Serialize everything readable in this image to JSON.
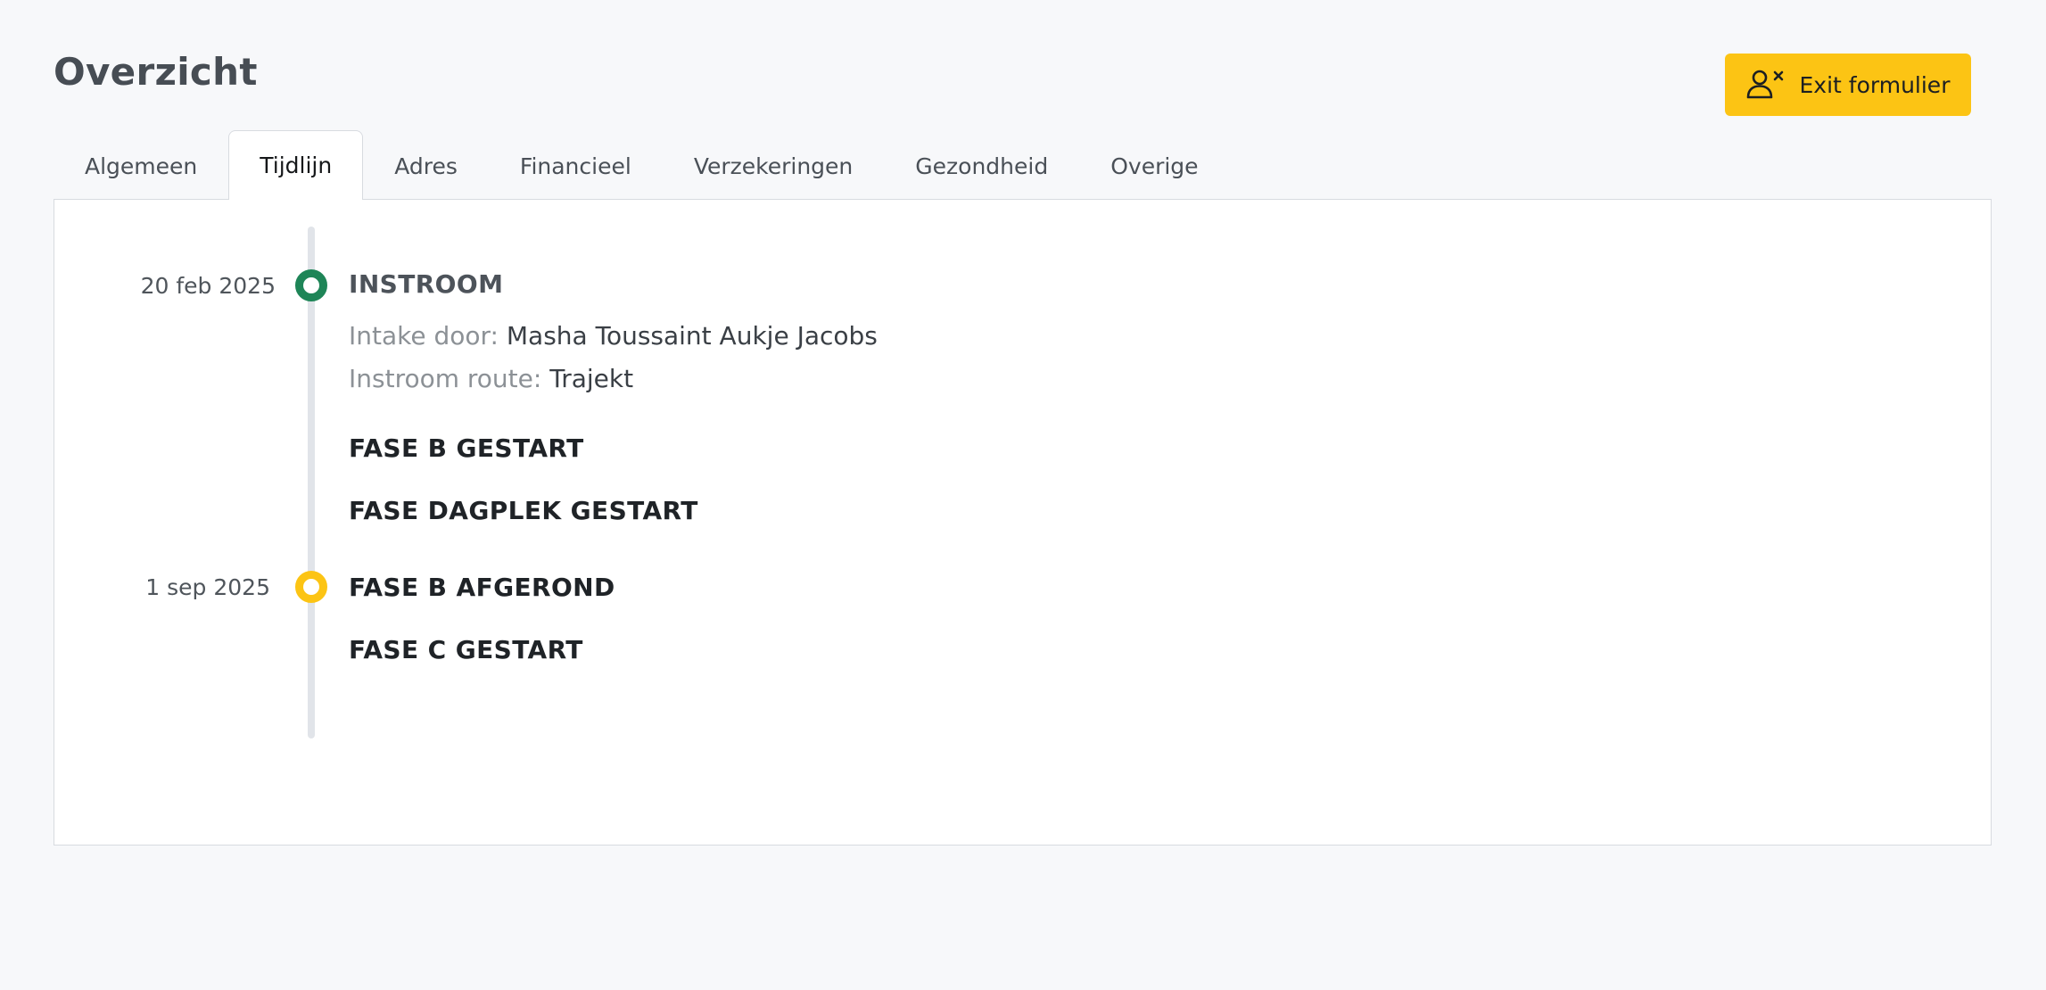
{
  "header": {
    "title": "Overzicht",
    "exit_label": "Exit formulier",
    "exit_icon": "user-remove-icon"
  },
  "tabs": [
    {
      "label": "Algemeen",
      "active": false
    },
    {
      "label": "Tijdlijn",
      "active": true
    },
    {
      "label": "Adres",
      "active": false
    },
    {
      "label": "Financieel",
      "active": false
    },
    {
      "label": "Verzekeringen",
      "active": false
    },
    {
      "label": "Gezondheid",
      "active": false
    },
    {
      "label": "Overige",
      "active": false
    }
  ],
  "timeline": {
    "groups": [
      {
        "date": "20 feb 2025",
        "status_color": "#1e8557",
        "events": [
          {
            "title": "INSTROOM",
            "details": [
              {
                "label": "Intake door:",
                "value": "Masha Toussaint Aukje Jacobs"
              },
              {
                "label": "Instroom route:",
                "value": "Trajekt"
              }
            ]
          },
          {
            "title": "FASE B GESTART"
          },
          {
            "title": "FASE DAGPLEK GESTART"
          }
        ]
      },
      {
        "date": "1 sep 2025",
        "status_color": "#fcc414",
        "events": [
          {
            "title": "FASE B AFGEROND"
          },
          {
            "title": "FASE C GESTART"
          }
        ]
      }
    ]
  },
  "colors": {
    "accent": "#fcc414",
    "success": "#1e8557"
  }
}
